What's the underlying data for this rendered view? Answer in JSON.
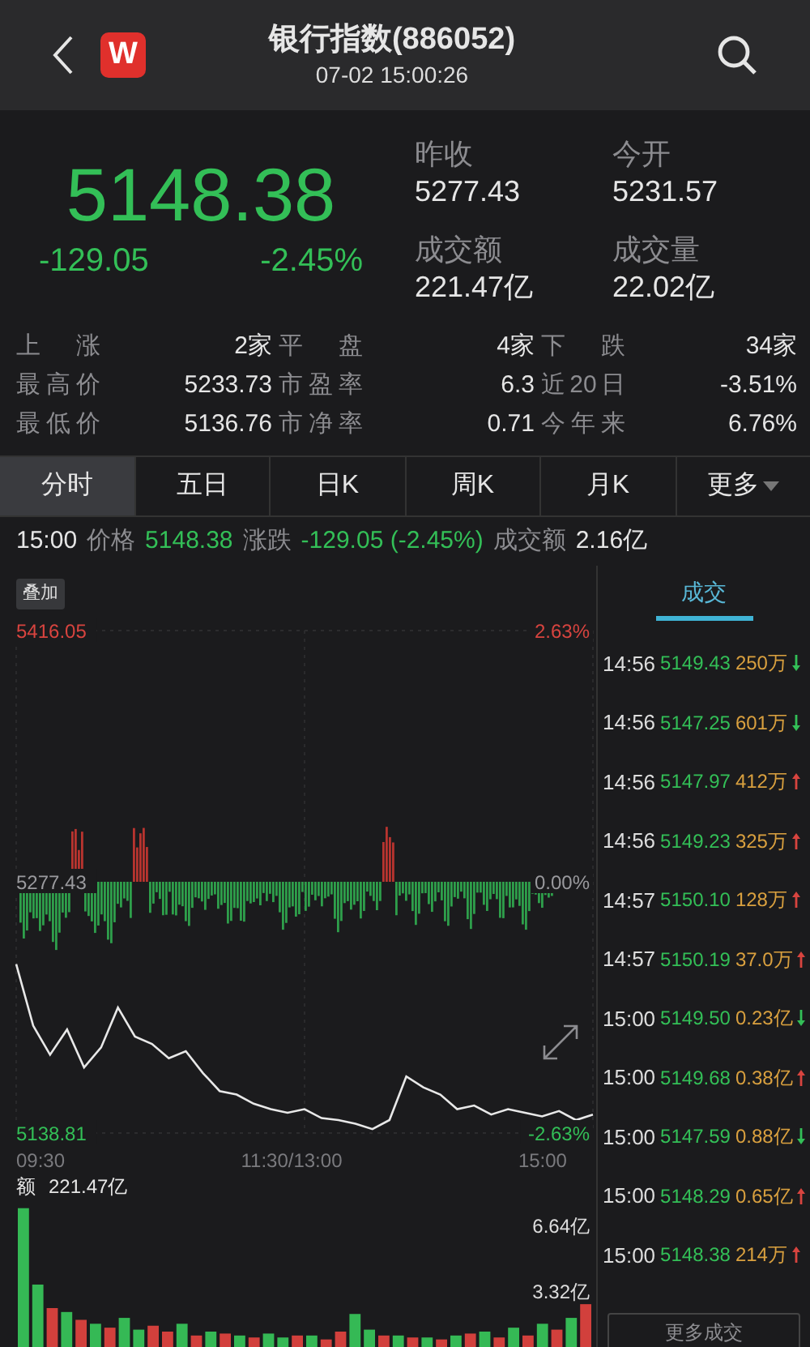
{
  "header": {
    "logo_text": "W",
    "title": "银行指数(886052)",
    "subtitle": "07-02 15:00:26"
  },
  "quote": {
    "price": "5148.38",
    "change": "-129.05",
    "change_pct": "-2.45%",
    "stats": [
      {
        "label": "昨收",
        "value": "5277.43"
      },
      {
        "label": "今开",
        "value": "5231.57"
      },
      {
        "label": "成交额",
        "value": "221.47亿"
      },
      {
        "label": "成交量",
        "value": "22.02亿"
      }
    ]
  },
  "breadth": [
    {
      "label": "上 涨",
      "value": "2家"
    },
    {
      "label": "平 盘",
      "value": "4家"
    },
    {
      "label": "下 跌",
      "value": "34家"
    },
    {
      "label": "最高价",
      "value": "5233.73"
    },
    {
      "label": "市盈率",
      "value": "6.3"
    },
    {
      "label": "近20日",
      "value": "-3.51%"
    },
    {
      "label": "最低价",
      "value": "5136.76"
    },
    {
      "label": "市净率",
      "value": "0.71"
    },
    {
      "label": "今年来",
      "value": "6.76%"
    }
  ],
  "tabs": [
    {
      "label": "分时",
      "selected": true
    },
    {
      "label": "五日",
      "selected": false
    },
    {
      "label": "日K",
      "selected": false
    },
    {
      "label": "周K",
      "selected": false
    },
    {
      "label": "月K",
      "selected": false
    },
    {
      "label": "更多",
      "selected": false,
      "dropdown": true
    }
  ],
  "info_line": {
    "time": "15:00",
    "price_label": "价格",
    "price": "5148.38",
    "change_label": "涨跌",
    "change": "-129.05 (-2.45%)",
    "amount_label": "成交额",
    "amount": "2.16亿"
  },
  "overlay_button": "叠加",
  "price_chart": {
    "chart_data": {
      "type": "line",
      "ylim": [
        5138.81,
        5416.05
      ],
      "yticks": [
        {
          "value": 5416.05,
          "label": "5416.05"
        },
        {
          "value": 5277.43,
          "label": "5277.43"
        },
        {
          "value": 5138.81,
          "label": "5138.81"
        }
      ],
      "series": [
        {
          "color": "#e8e8e8",
          "values": [
            5232,
            5198,
            5182,
            5196,
            5175,
            5186,
            5208,
            5192,
            5188,
            5180,
            5184,
            5172,
            5162,
            5160,
            5155,
            5152,
            5150,
            5152,
            5147,
            5146,
            5144,
            5141,
            5146,
            5170,
            5164,
            5160,
            5152,
            5154,
            5149,
            5152,
            5150,
            5148,
            5151,
            5146,
            5149
          ]
        }
      ]
    },
    "right_labels": [
      {
        "label": "2.63%",
        "color": "#d8443f"
      },
      {
        "label": "0.00%",
        "color": "#9a9a9e"
      },
      {
        "label": "-2.63%",
        "color": "#33bf57"
      }
    ],
    "time_axis": [
      "09:30",
      "11:30/13:00",
      "15:00"
    ]
  },
  "volume_chart": {
    "title": "额",
    "total": "221.47亿",
    "chart_data": {
      "type": "bar",
      "stacked": true,
      "ylim": [
        0,
        7.86
      ],
      "yticks": [
        {
          "value": 6.64,
          "label": "6.64亿"
        },
        {
          "value": 3.32,
          "label": "3.32亿"
        }
      ],
      "series": [
        {
          "color": "#d2403c",
          "values": [
            null,
            null,
            2.4,
            null,
            1.8,
            null,
            1.4,
            null,
            null,
            1.5,
            1.2,
            null,
            1.0,
            null,
            1.1,
            null,
            0.9,
            null,
            null,
            1.0,
            null,
            0.8,
            1.2,
            null,
            null,
            1.0,
            null,
            0.9,
            null,
            0.8,
            null,
            1.1,
            null,
            0.9,
            null,
            1.0,
            null,
            1.3,
            null,
            2.6
          ]
        },
        {
          "color": "#35b955",
          "values": [
            7.5,
            3.6,
            null,
            2.2,
            null,
            1.6,
            null,
            1.9,
            1.3,
            null,
            null,
            1.6,
            null,
            1.2,
            null,
            1.0,
            null,
            1.1,
            0.9,
            null,
            1.0,
            null,
            null,
            2.1,
            1.3,
            null,
            1.0,
            null,
            0.9,
            null,
            1.0,
            null,
            1.2,
            null,
            1.4,
            null,
            1.6,
            null,
            1.9,
            null
          ]
        }
      ]
    }
  },
  "trades_tab": {
    "label": "成交",
    "selected": true
  },
  "trades": [
    {
      "time": "14:56",
      "price": "5149.43",
      "volume": "250万",
      "up": false
    },
    {
      "time": "14:56",
      "price": "5147.25",
      "volume": "601万",
      "up": false
    },
    {
      "time": "14:56",
      "price": "5147.97",
      "volume": "412万",
      "up": true
    },
    {
      "time": "14:56",
      "price": "5149.23",
      "volume": "325万",
      "up": true
    },
    {
      "time": "14:57",
      "price": "5150.10",
      "volume": "128万",
      "up": true
    },
    {
      "time": "14:57",
      "price": "5150.19",
      "volume": "37.0万",
      "up": true
    },
    {
      "time": "15:00",
      "price": "5149.50",
      "volume": "0.23亿",
      "up": false
    },
    {
      "time": "15:00",
      "price": "5149.68",
      "volume": "0.38亿",
      "up": true
    },
    {
      "time": "15:00",
      "price": "5147.59",
      "volume": "0.88亿",
      "up": false
    },
    {
      "time": "15:00",
      "price": "5148.29",
      "volume": "0.65亿",
      "up": true
    },
    {
      "time": "15:00",
      "price": "5148.38",
      "volume": "214万",
      "up": true
    }
  ],
  "more_trades_button": "更多成交"
}
